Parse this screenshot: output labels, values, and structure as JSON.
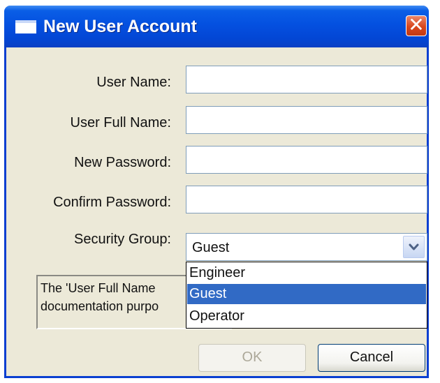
{
  "window": {
    "title": "New User Account",
    "close_label": "✕"
  },
  "form": {
    "fields": [
      {
        "label": "User Name:",
        "value": ""
      },
      {
        "label": "User Full Name:",
        "value": ""
      },
      {
        "label": "New Password:",
        "value": ""
      },
      {
        "label": "Confirm Password:",
        "value": ""
      }
    ],
    "security_group": {
      "label": "Security Group:",
      "selected": "Guest",
      "options": [
        "Engineer",
        "Guest",
        "Operator"
      ]
    }
  },
  "info": {
    "text": "The 'User Full Name\ndocumentation purpo"
  },
  "buttons": {
    "ok_label": "OK",
    "cancel_label": "Cancel"
  },
  "colors": {
    "titlebar": "#0450e0",
    "selection": "#316ac5",
    "dialog_bg": "#ece9d8"
  }
}
